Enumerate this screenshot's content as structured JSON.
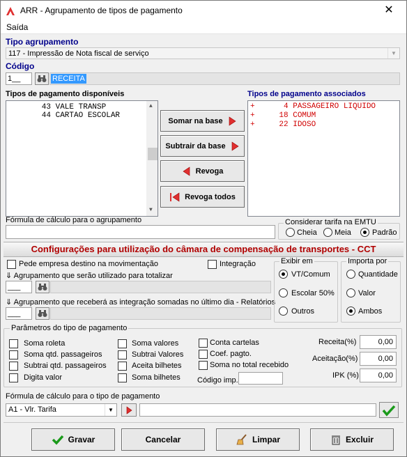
{
  "window": {
    "title": "ARR - Agrupamento de tipos de pagamento",
    "close_glyph": "✕"
  },
  "menu": {
    "saida": "Saída"
  },
  "tipo_agrupamento": {
    "label": "Tipo agrupamento",
    "value": "117 - Impressão de Nota fiscal de serviço"
  },
  "codigo": {
    "label": "Código",
    "value": "1__",
    "description": "RECEITA"
  },
  "disponiveis": {
    "label": "Tipos de pagamento disponíveis",
    "items": [
      {
        "code": "43",
        "name": "VALE TRANSP"
      },
      {
        "code": "44",
        "name": "CARTAO ESCOLAR"
      }
    ]
  },
  "associados": {
    "label": "Tipos de pagamento associados",
    "items": [
      {
        "flag": "+",
        "code": "4",
        "name": "PASSAGEIRO LIQUIDO"
      },
      {
        "flag": "+",
        "code": "18",
        "name": "COMUM"
      },
      {
        "flag": "+",
        "code": "22",
        "name": "IDOSO"
      }
    ]
  },
  "actions": {
    "somar_base": "Somar na base",
    "subtrair_base": "Subtrair da base",
    "revoga": "Revoga",
    "revoga_todos": "Revoga todos"
  },
  "formula_agrupamento": {
    "label": "Fórmula de cálculo para o agrupamento",
    "value": ""
  },
  "tarifa_emtu": {
    "label": "Considerar tarifa na EMTU",
    "options": [
      "Cheia",
      "Meia",
      "Padrão"
    ],
    "selected": "Padrão"
  },
  "cct_header": "Configurações para utilização do câmara de compensação de transportes - CCT",
  "cct": {
    "pede_empresa": "Pede empresa destino na movimentação",
    "integracao": "Integração",
    "agrup_totalizar": "Agrupamento que serão utilizado para totalizar",
    "agrup_integracao": "Agrupamento que receberá as integração somadas no último dia - Relatórios",
    "agrup_totalizar_value": "___",
    "agrup_integracao_value": "___"
  },
  "exibir_em": {
    "label": "Exibir em",
    "options": [
      "VT/Comum",
      "Escolar 50%",
      "Outros"
    ],
    "selected": "VT/Comum"
  },
  "importa_por": {
    "label": "Importa por",
    "options": [
      "Quantidade",
      "Valor",
      "Ambos"
    ],
    "selected": "Ambos"
  },
  "parametros": {
    "label": "Parâmetros do tipo de pagamento",
    "col1": [
      "Soma roleta",
      "Soma qtd. passageiros",
      "Subtrai qtd. passageiros",
      "Digita valor"
    ],
    "col2": [
      "Soma valores",
      "Subtrai Valores",
      "Aceita bilhetes",
      "Soma bilhetes"
    ],
    "col3": [
      "Conta cartelas",
      "Coef. pagto.",
      "Soma no total recebido"
    ],
    "codigo_imp": "Código imp.",
    "receita_label": "Receita(%)",
    "receita_value": "0,00",
    "aceitacao_label": "Aceitação(%)",
    "aceitacao_value": "0,00",
    "ipk_label": "IPK (%)",
    "ipk_value": "0,00"
  },
  "formula_tipo": {
    "label": "Fórmula de cálculo para o tipo de pagamento",
    "selected": "A1 - Vlr. Tarifa",
    "value": ""
  },
  "footer": {
    "gravar": "Gravar",
    "cancelar": "Cancelar",
    "limpar": "Limpar",
    "excluir": "Excluir"
  },
  "colors": {
    "accent_blue": "#00008b",
    "assoc_red": "#d00000",
    "header_red": "#b00000",
    "selection": "#3399ff"
  }
}
